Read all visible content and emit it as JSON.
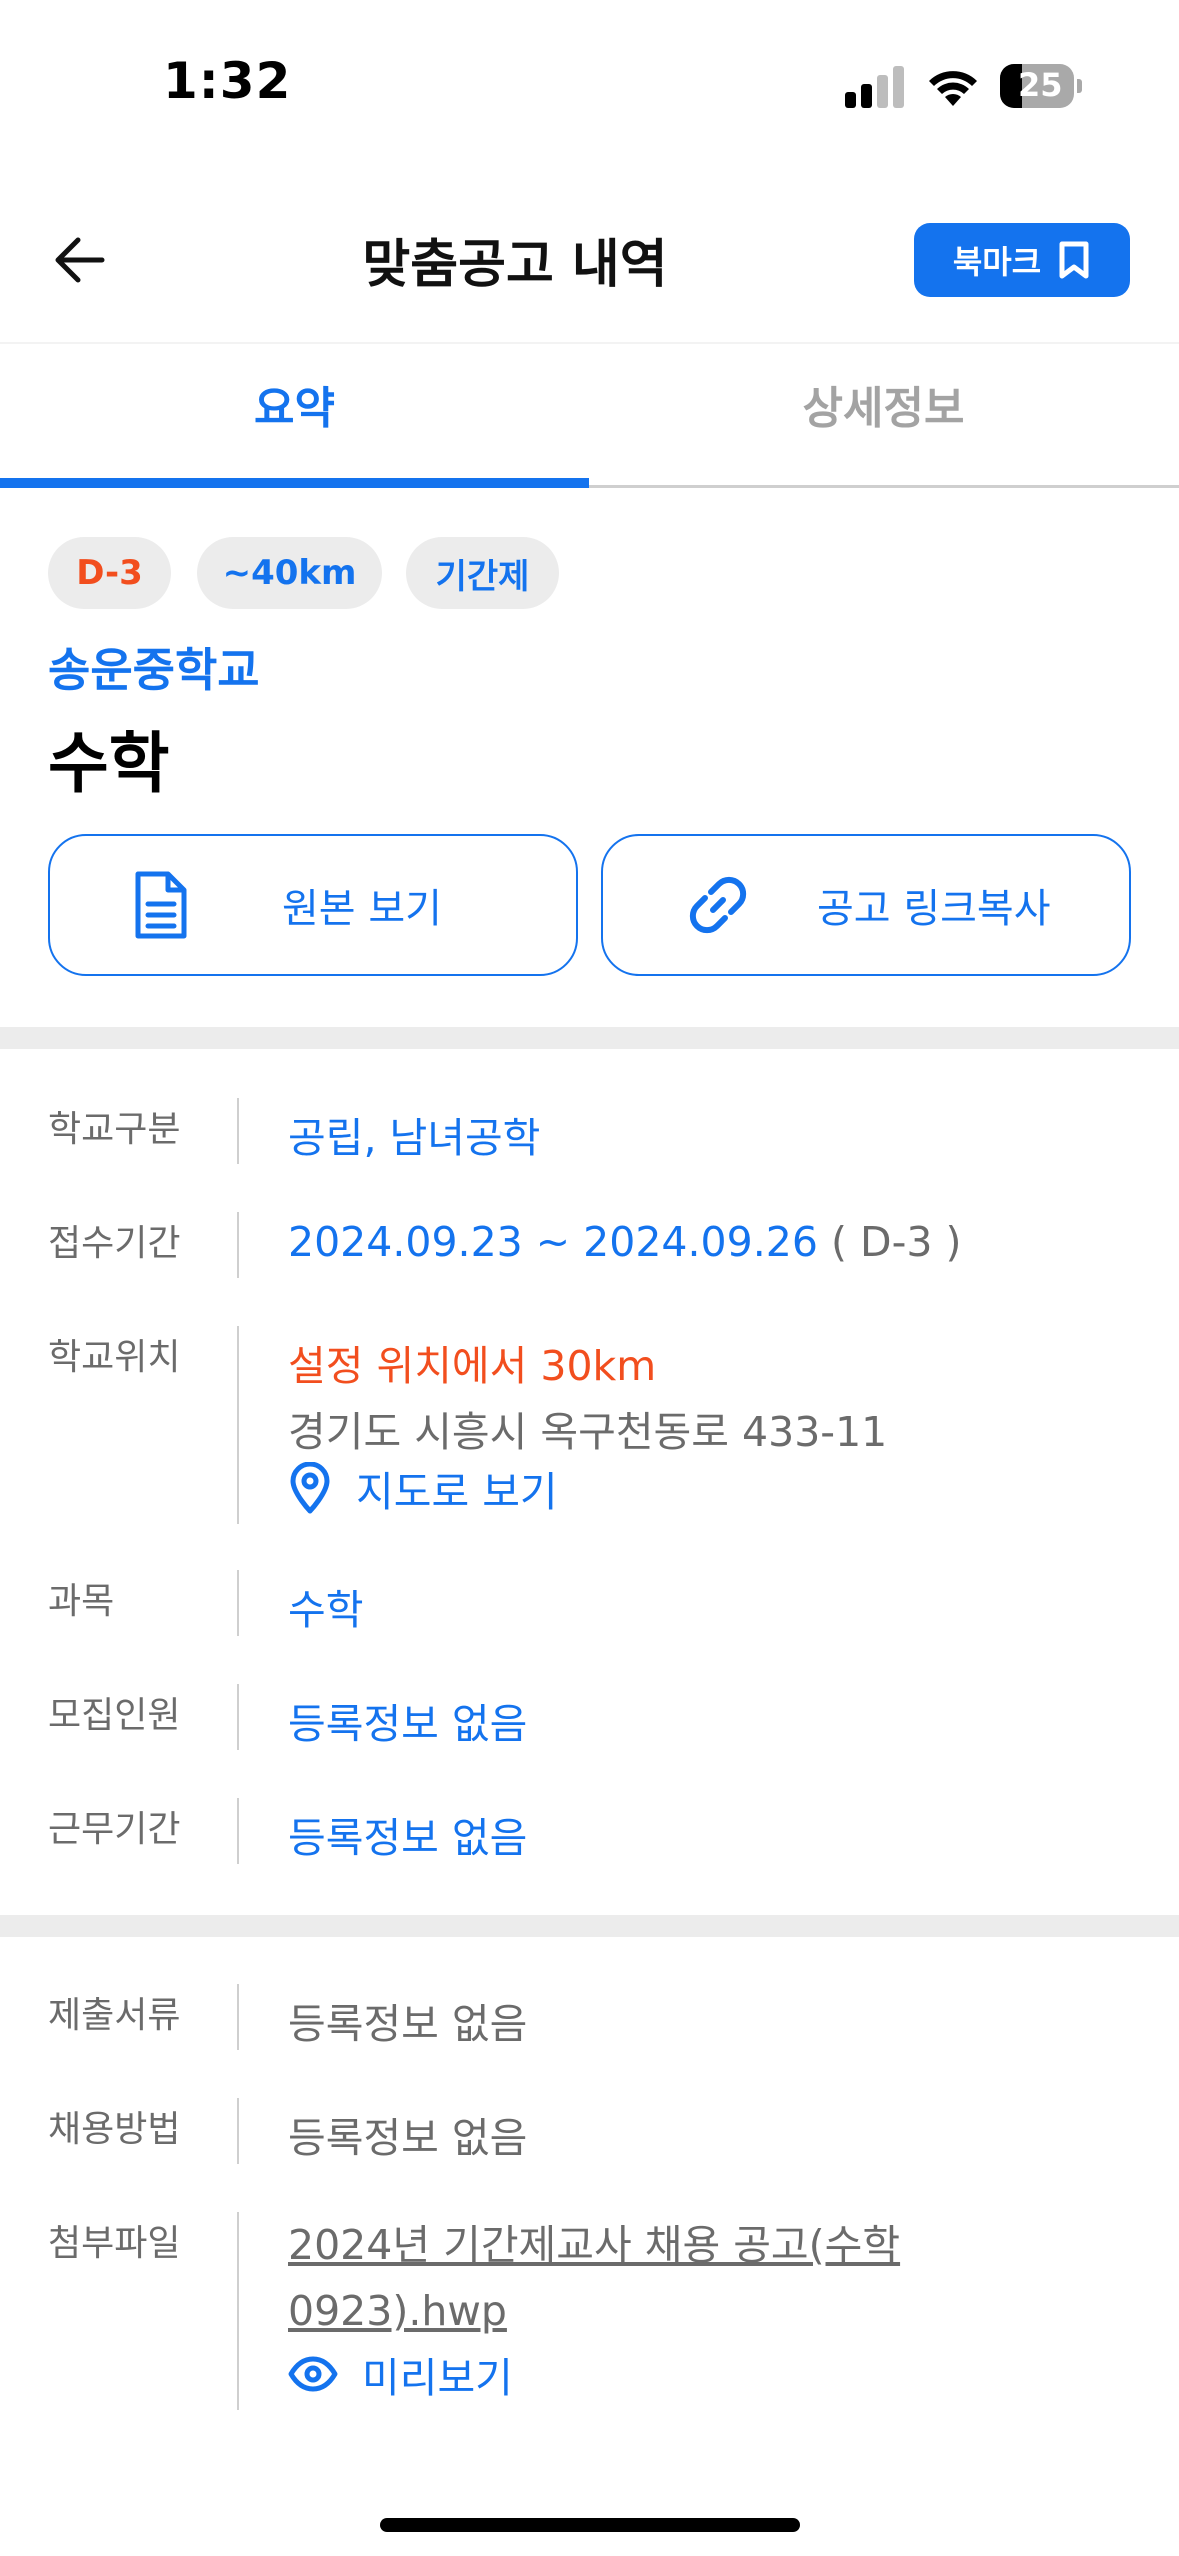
{
  "status_bar": {
    "time": "1:32",
    "battery": "25"
  },
  "header": {
    "title": "맞춤공고 내역",
    "bookmark_label": "북마크"
  },
  "tabs": [
    {
      "label": "요약",
      "active": true
    },
    {
      "label": "상세정보",
      "active": false
    }
  ],
  "chips": {
    "deadline": "D-3",
    "distance": "~40km",
    "type": "기간제"
  },
  "school_name": "송운중학교",
  "subject": "수학",
  "actions": {
    "view_original": "원본 보기",
    "copy_link": "공고 링크복사"
  },
  "info": {
    "school_type": {
      "label": "학교구분",
      "value": "공립, 남녀공학"
    },
    "period": {
      "label": "접수기간",
      "value": "2024.09.23 ~ 2024.09.26",
      "dday": "( D-3 )"
    },
    "location": {
      "label": "학교위치",
      "distance": "설정 위치에서 30km",
      "address": "경기도 시흥시 옥구천동로 433-11",
      "map_link": "지도로 보기"
    },
    "course": {
      "label": "과목",
      "value": "수학"
    },
    "recruits": {
      "label": "모집인원",
      "value": "등록정보 없음"
    },
    "work_period": {
      "label": "근무기간",
      "value": "등록정보 없음"
    }
  },
  "extra": {
    "documents": {
      "label": "제출서류",
      "value": "등록정보 없음"
    },
    "method": {
      "label": "채용방법",
      "value": "등록정보 없음"
    },
    "attachment": {
      "label": "첨부파일",
      "file": "2024년 기간제교사 채용 공고(수학0923).hwp",
      "preview": "미리보기"
    }
  },
  "colors": {
    "accent": "#1473ee",
    "warning": "#f24e1e",
    "muted": "#6b6b6b",
    "divider": "#ececec"
  }
}
